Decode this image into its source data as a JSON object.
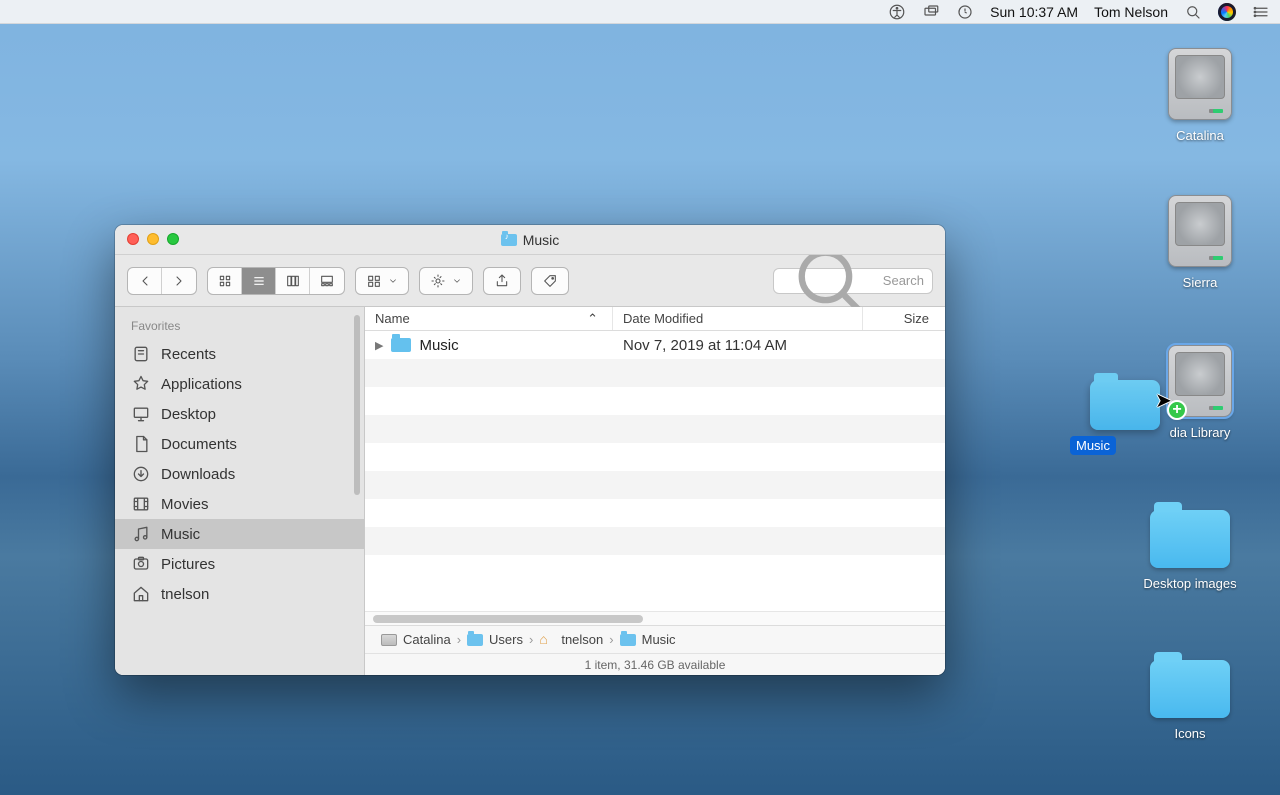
{
  "menubar": {
    "datetime": "Sun 10:37 AM",
    "user": "Tom Nelson"
  },
  "desktop": {
    "items": [
      {
        "label": "Catalina",
        "type": "disk"
      },
      {
        "label": "Sierra",
        "type": "disk"
      },
      {
        "label": "dia Library",
        "type": "disk"
      },
      {
        "label": "Desktop images",
        "type": "folder"
      },
      {
        "label": "Icons",
        "type": "folder"
      }
    ],
    "drag_label": "Music"
  },
  "finder": {
    "title": "Music",
    "toolbar": {
      "search_placeholder": "Search"
    },
    "sidebar": {
      "header": "Favorites",
      "items": [
        "Recents",
        "Applications",
        "Desktop",
        "Documents",
        "Downloads",
        "Movies",
        "Music",
        "Pictures",
        "tnelson"
      ],
      "selected": "Music"
    },
    "columns": {
      "name": "Name",
      "date": "Date Modified",
      "size": "Size"
    },
    "rows": [
      {
        "name": "Music",
        "date": "Nov 7, 2019 at 11:04 AM"
      }
    ],
    "path": [
      "Catalina",
      "Users",
      "tnelson",
      "Music"
    ],
    "status": "1 item, 31.46 GB available"
  }
}
